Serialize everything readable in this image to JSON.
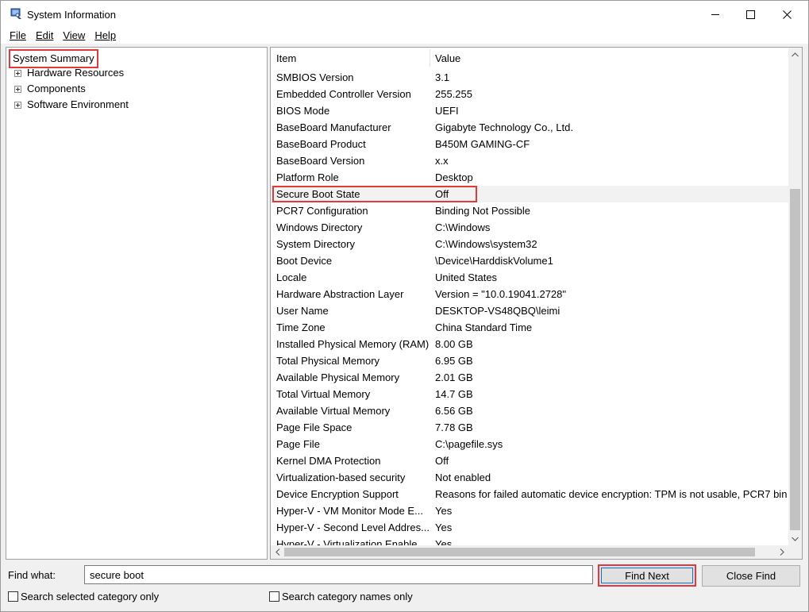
{
  "window": {
    "title": "System Information"
  },
  "menu": [
    {
      "label": "File"
    },
    {
      "label": "Edit"
    },
    {
      "label": "View"
    },
    {
      "label": "Help"
    }
  ],
  "tree": {
    "root": "System Summary",
    "children": [
      {
        "label": "Hardware Resources"
      },
      {
        "label": "Components"
      },
      {
        "label": "Software Environment"
      }
    ]
  },
  "list": {
    "col_item": "Item",
    "col_value": "Value",
    "rows": [
      {
        "item": "SMBIOS Version",
        "value": "3.1"
      },
      {
        "item": "Embedded Controller Version",
        "value": "255.255"
      },
      {
        "item": "BIOS Mode",
        "value": "UEFI"
      },
      {
        "item": "BaseBoard Manufacturer",
        "value": "Gigabyte Technology Co., Ltd."
      },
      {
        "item": "BaseBoard Product",
        "value": "B450M GAMING-CF"
      },
      {
        "item": "BaseBoard Version",
        "value": "x.x"
      },
      {
        "item": "Platform Role",
        "value": "Desktop"
      },
      {
        "item": "Secure Boot State",
        "value": "Off",
        "selected": true
      },
      {
        "item": "PCR7 Configuration",
        "value": "Binding Not Possible"
      },
      {
        "item": "Windows Directory",
        "value": "C:\\Windows"
      },
      {
        "item": "System Directory",
        "value": "C:\\Windows\\system32"
      },
      {
        "item": "Boot Device",
        "value": "\\Device\\HarddiskVolume1"
      },
      {
        "item": "Locale",
        "value": "United States"
      },
      {
        "item": "Hardware Abstraction Layer",
        "value": "Version = \"10.0.19041.2728\""
      },
      {
        "item": "User Name",
        "value": "DESKTOP-VS48QBQ\\leimi"
      },
      {
        "item": "Time Zone",
        "value": "China Standard Time"
      },
      {
        "item": "Installed Physical Memory (RAM)",
        "value": "8.00 GB"
      },
      {
        "item": "Total Physical Memory",
        "value": "6.95 GB"
      },
      {
        "item": "Available Physical Memory",
        "value": "2.01 GB"
      },
      {
        "item": "Total Virtual Memory",
        "value": "14.7 GB"
      },
      {
        "item": "Available Virtual Memory",
        "value": "6.56 GB"
      },
      {
        "item": "Page File Space",
        "value": "7.78 GB"
      },
      {
        "item": "Page File",
        "value": "C:\\pagefile.sys"
      },
      {
        "item": "Kernel DMA Protection",
        "value": "Off"
      },
      {
        "item": "Virtualization-based security",
        "value": "Not enabled"
      },
      {
        "item": "Device Encryption Support",
        "value": "Reasons for failed automatic device encryption: TPM is not usable, PCR7 bin"
      },
      {
        "item": "Hyper-V - VM Monitor Mode E...",
        "value": "Yes"
      },
      {
        "item": "Hyper-V - Second Level Addres...",
        "value": "Yes"
      },
      {
        "item": "Hyper-V - Virtualization Enable...",
        "value": "Yes"
      }
    ]
  },
  "find": {
    "label": "Find what:",
    "value": "secure boot",
    "find_next": "Find Next",
    "close_find": "Close Find",
    "search_selected": "Search selected category only",
    "search_names": "Search category names only"
  }
}
